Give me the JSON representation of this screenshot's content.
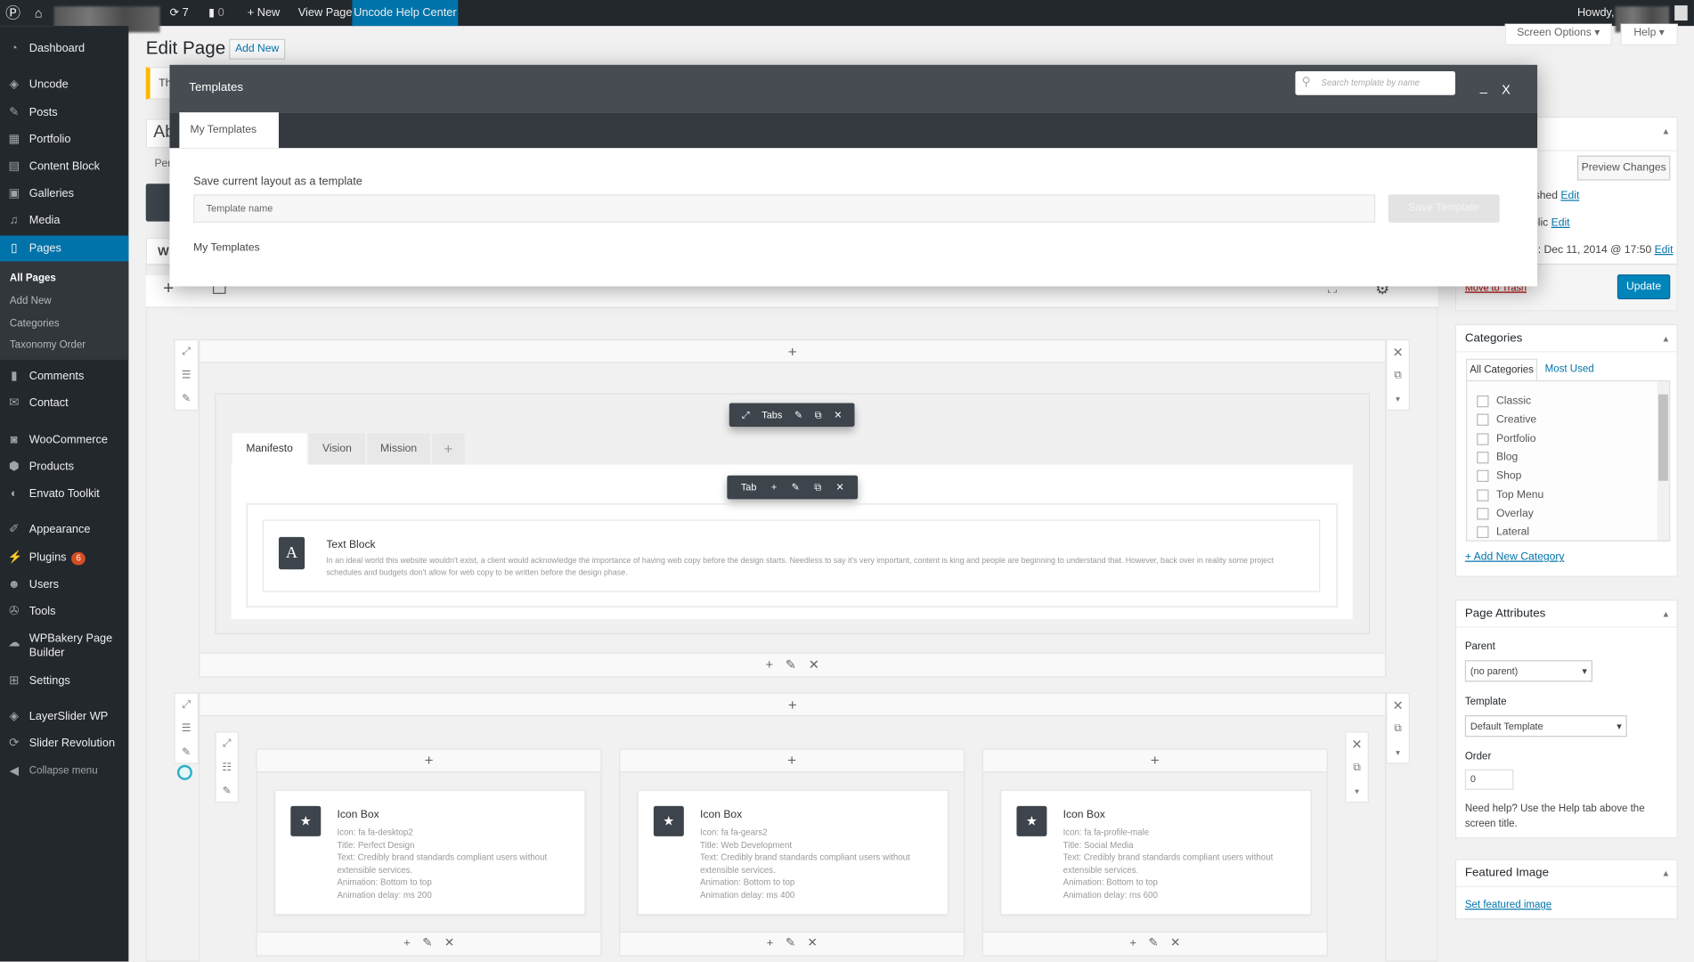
{
  "adminbar": {
    "updates": "7",
    "comments": "0",
    "new": "New",
    "view_page": "View Page",
    "help_center": "Uncode Help Center",
    "howdy": "Howdy,"
  },
  "sidebar": {
    "items": [
      {
        "label": "Dashboard",
        "icon": "dashboard-icon"
      },
      {
        "label": "Uncode",
        "icon": "layers-icon"
      },
      {
        "label": "Posts",
        "icon": "pin-icon"
      },
      {
        "label": "Portfolio",
        "icon": "grid-icon"
      },
      {
        "label": "Content Block",
        "icon": "block-icon"
      },
      {
        "label": "Galleries",
        "icon": "gallery-icon"
      },
      {
        "label": "Media",
        "icon": "media-icon"
      },
      {
        "label": "Pages",
        "icon": "page-icon"
      },
      {
        "label": "Comments",
        "icon": "comment-icon"
      },
      {
        "label": "Contact",
        "icon": "mail-icon"
      },
      {
        "label": "WooCommerce",
        "icon": "woo-icon"
      },
      {
        "label": "Products",
        "icon": "box-icon"
      },
      {
        "label": "Envato Toolkit",
        "icon": "leaf-icon"
      },
      {
        "label": "Appearance",
        "icon": "brush-icon"
      },
      {
        "label": "Plugins",
        "icon": "plug-icon",
        "badge": "6"
      },
      {
        "label": "Users",
        "icon": "user-icon"
      },
      {
        "label": "Tools",
        "icon": "wrench-icon"
      },
      {
        "label": "WPBakery Page",
        "label2": "Builder",
        "icon": "wpb-icon"
      },
      {
        "label": "Settings",
        "icon": "settings-icon"
      },
      {
        "label": "LayerSlider WP",
        "icon": "layers-icon"
      },
      {
        "label": "Slider Revolution",
        "icon": "refresh-icon"
      },
      {
        "label": "Collapse menu",
        "icon": "collapse-icon"
      }
    ],
    "submenu": [
      "All Pages",
      "Add New",
      "Categories",
      "Taxonomy Order"
    ]
  },
  "page": {
    "title": "Edit Page",
    "add_new": "Add New",
    "screen_options": "Screen Options",
    "help": "Help",
    "notice_partial": "Th",
    "title_partial": "Ab",
    "permalink_partial": "Per",
    "wpb_partial": "WI"
  },
  "modal": {
    "title": "Templates",
    "search_placeholder": "Search template by name",
    "minimize": "_",
    "close": "X",
    "tab": "My Templates",
    "save_label": "Save current layout as a template",
    "name_placeholder": "Template name",
    "save_button": "Save Template",
    "list_label": "My Templates"
  },
  "builder": {
    "tabs_label": "Tabs",
    "tab_label": "Tab",
    "tabs": [
      "Manifesto",
      "Vision",
      "Mission"
    ],
    "text_block": {
      "title": "Text Block",
      "text": "In an ideal world this website wouldn't exist, a client would acknowledge the importance of having web copy before the design starts. Needless to say it's very important, content is king and people are beginning to understand that. However, back over in reality some project schedules and budgets don't allow for web copy to be written before the design phase."
    },
    "icon_boxes": [
      {
        "title": "Icon Box",
        "lines": [
          "Icon: fa fa-desktop2",
          "Title: Perfect Design",
          "Text: Credibly brand standards compliant users without extensible services.",
          "Animation: Bottom to top",
          "Animation delay: ms 200"
        ]
      },
      {
        "title": "Icon Box",
        "lines": [
          "Icon: fa fa-gears2",
          "Title: Web Development",
          "Text: Credibly brand standards compliant users without extensible services.",
          "Animation: Bottom to top",
          "Animation delay: ms 400"
        ]
      },
      {
        "title": "Icon Box",
        "lines": [
          "Icon: fa fa-profile-male",
          "Title: Social Media",
          "Text: Credibly brand standards compliant users without extensible services.",
          "Animation: Bottom to top",
          "Animation delay: ms 600"
        ]
      }
    ]
  },
  "publish": {
    "preview": "Preview Changes",
    "status": "ished",
    "status_edit": "Edit",
    "visibility": "blic",
    "visibility_edit": "Edit",
    "date": "n: Dec 11, 2014 @ 17:50",
    "date_edit": "Edit",
    "trash": "Move to Trash",
    "update": "Update"
  },
  "categories": {
    "title": "Categories",
    "tab_all": "All Categories",
    "tab_used": "Most Used",
    "items": [
      "Classic",
      "Creative",
      "Portfolio",
      "Blog",
      "Shop",
      "Top Menu",
      "Overlay",
      "Lateral"
    ],
    "add": "+ Add New Category"
  },
  "attributes": {
    "title": "Page Attributes",
    "parent_label": "Parent",
    "parent_value": "(no parent)",
    "template_label": "Template",
    "template_value": "Default Template",
    "order_label": "Order",
    "order_value": "0",
    "help": "Need help? Use the Help tab above the screen title."
  },
  "featured": {
    "title": "Featured Image",
    "link": "Set featured image"
  },
  "colors": {
    "accent": "#0073aa",
    "adminbar": "#23282d",
    "modal_header": "#474c53",
    "modal_tabs": "#353a40"
  }
}
